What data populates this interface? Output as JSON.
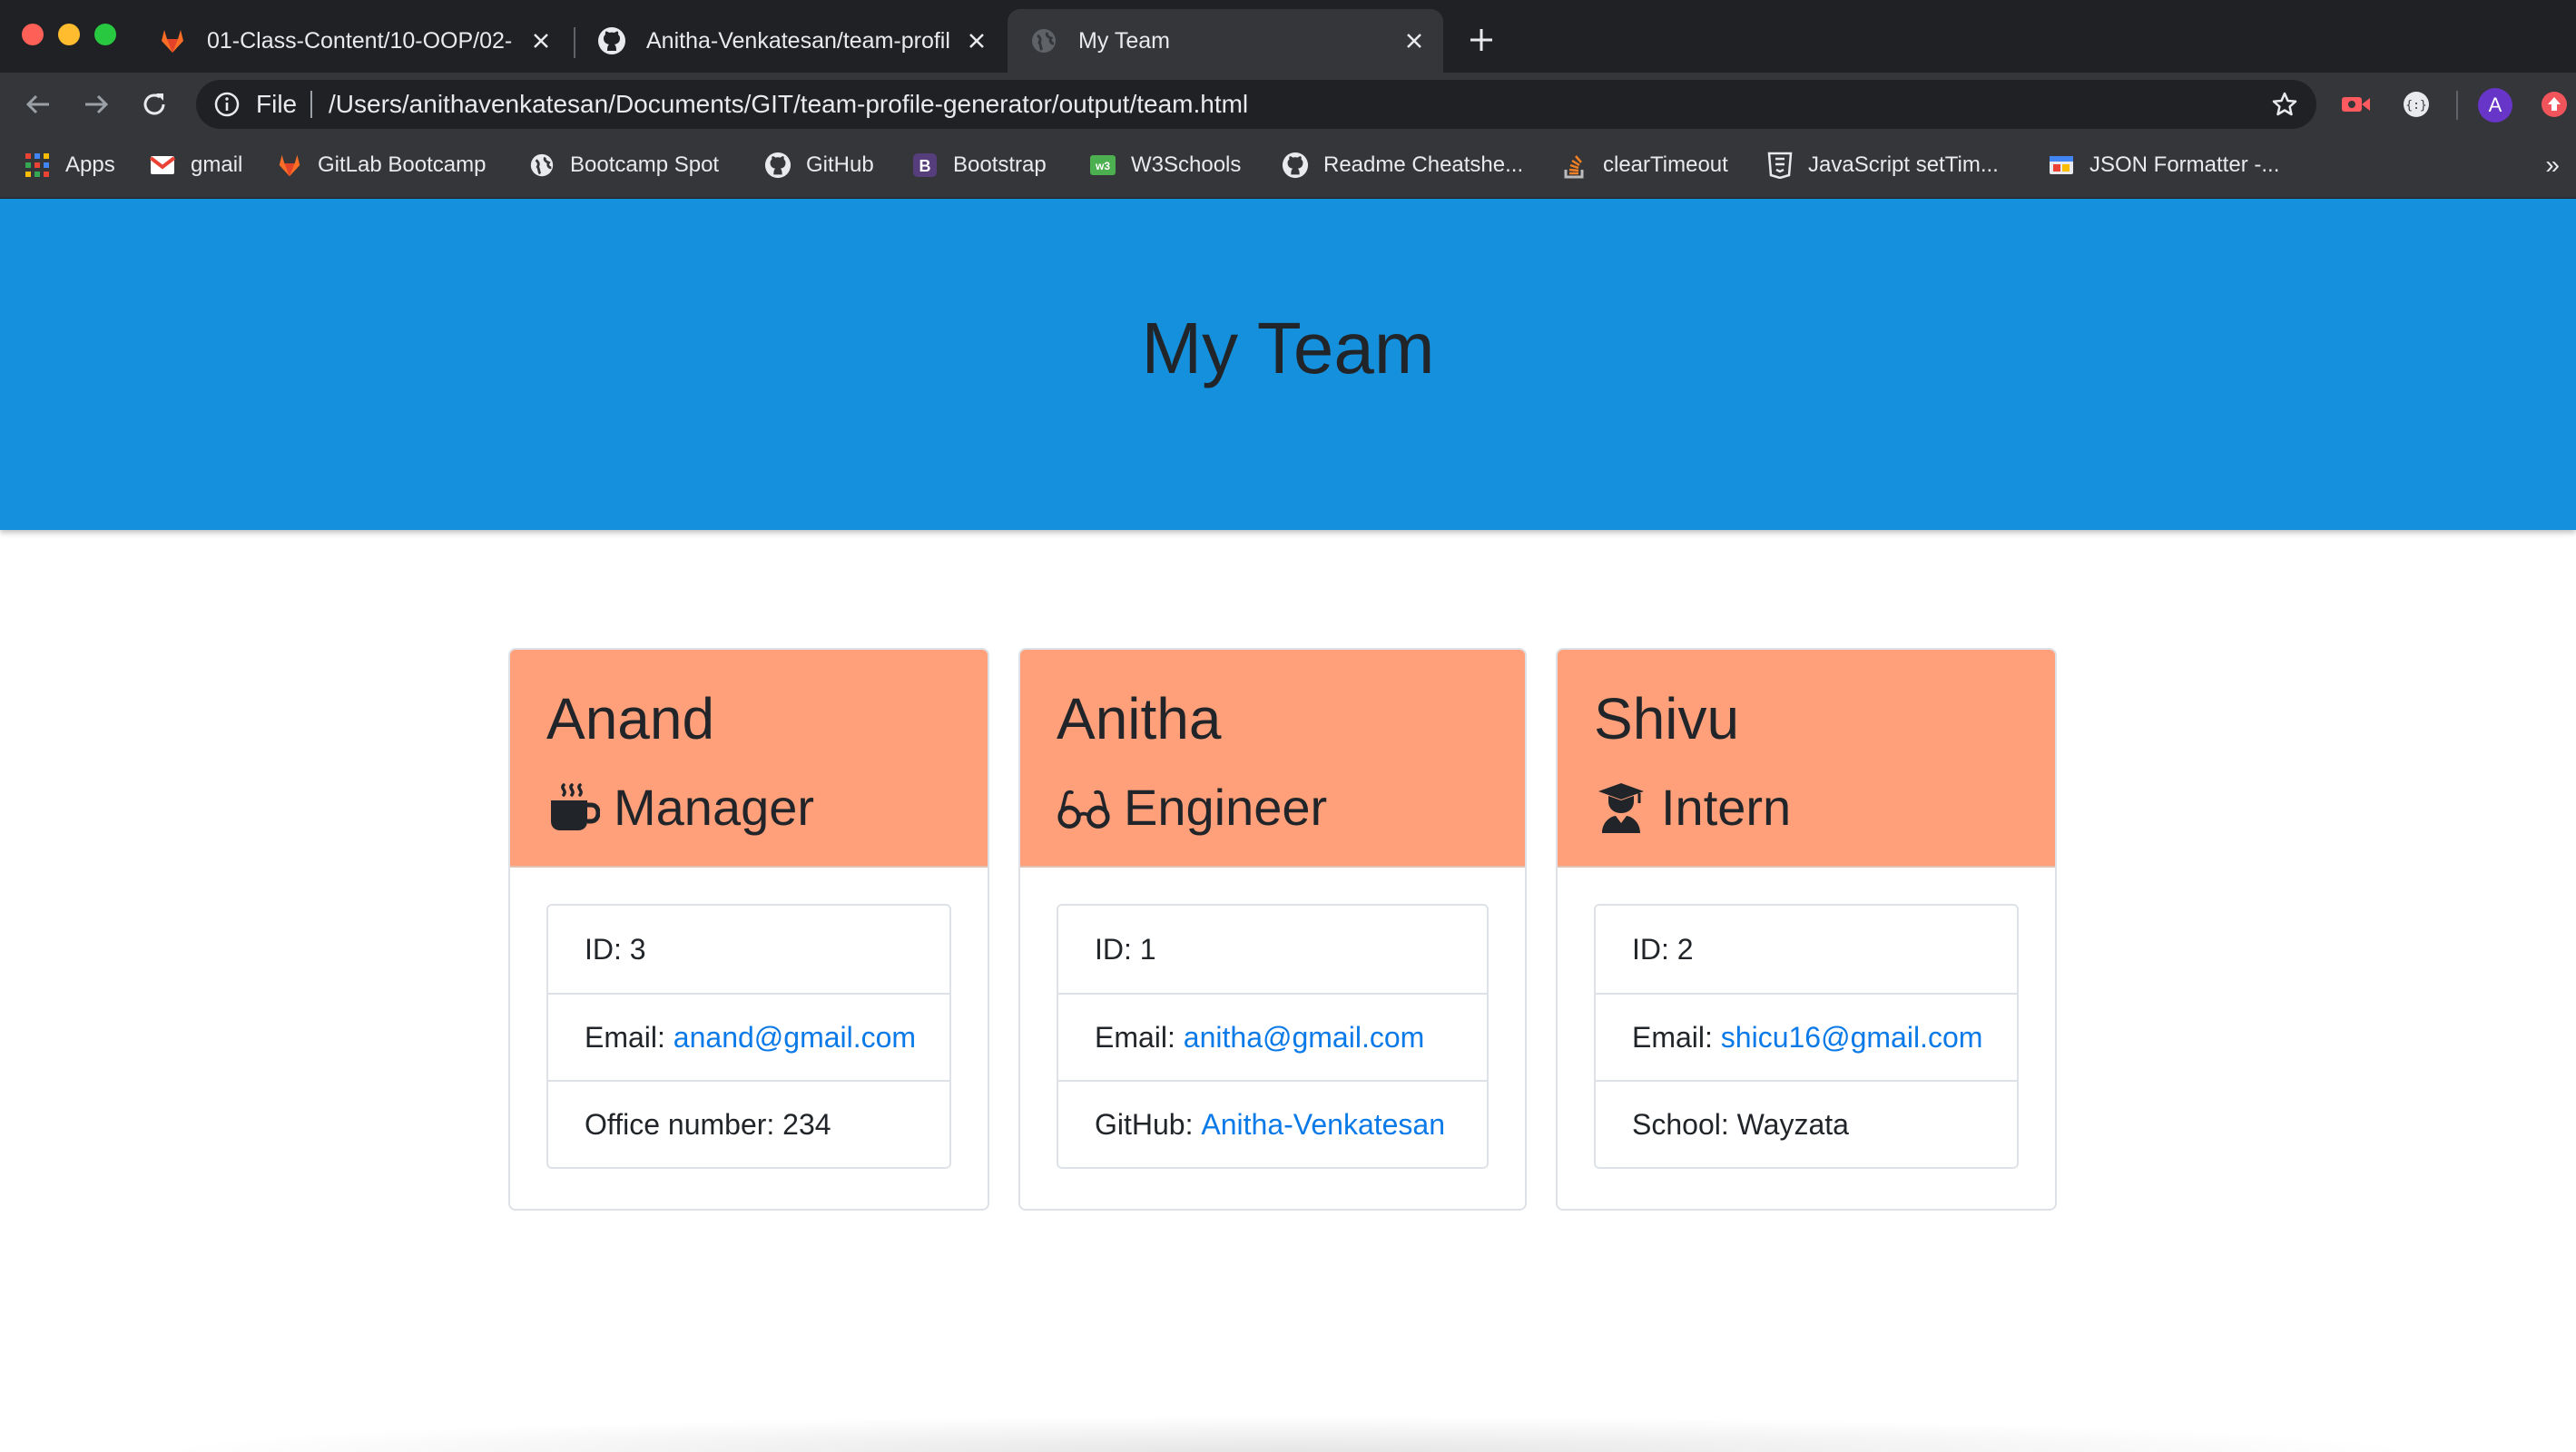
{
  "browser": {
    "tabs": [
      {
        "title": "01-Class-Content/10-OOP/02-",
        "icon": "gitlab-icon"
      },
      {
        "title": "Anitha-Venkatesan/team-profil",
        "icon": "github-icon"
      },
      {
        "title": "My Team",
        "icon": "globe-icon",
        "active": true
      }
    ],
    "address": {
      "scheme_label": "File",
      "url": "/Users/anithavenkatesan/Documents/GIT/team-profile-generator/output/team.html"
    },
    "avatar_letter": "A",
    "bookmarks": [
      {
        "label": "Apps",
        "icon": "apps-grid-icon"
      },
      {
        "label": "gmail",
        "icon": "gmail-icon"
      },
      {
        "label": "GitLab Bootcamp",
        "icon": "gitlab-icon"
      },
      {
        "label": "Bootcamp Spot",
        "icon": "globe-icon"
      },
      {
        "label": "GitHub",
        "icon": "github-icon"
      },
      {
        "label": "Bootstrap",
        "icon": "bootstrap-icon"
      },
      {
        "label": "W3Schools",
        "icon": "w3schools-icon"
      },
      {
        "label": "Readme Cheatshe...",
        "icon": "github-icon"
      },
      {
        "label": "clearTimeout",
        "icon": "stackoverflow-icon"
      },
      {
        "label": "JavaScript setTim...",
        "icon": "html5-icon"
      },
      {
        "label": "JSON Formatter -...",
        "icon": "json-formatter-icon"
      }
    ],
    "more_label": "»"
  },
  "page": {
    "title": "My Team",
    "colors": {
      "header_bg": "#1590dd",
      "card_header_bg": "#ffa07a",
      "link": "#0a7ae8"
    },
    "employees": [
      {
        "name": "Anand",
        "role": "Manager",
        "role_icon": "coffee-mug-icon",
        "id_label": "ID: 3",
        "email_label": "Email: ",
        "email": "anand@gmail.com",
        "extra_label": "Office number: 234",
        "extra_value": ""
      },
      {
        "name": "Anitha",
        "role": "Engineer",
        "role_icon": "glasses-icon",
        "id_label": "ID: 1",
        "email_label": "Email: ",
        "email": "anitha@gmail.com",
        "extra_label": "GitHub: ",
        "extra_value": "Anitha-Venkatesan"
      },
      {
        "name": "Shivu",
        "role": "Intern",
        "role_icon": "graduate-icon",
        "id_label": "ID: 2",
        "email_label": "Email: ",
        "email": "shicu16@gmail.com",
        "extra_label": "School: Wayzata",
        "extra_value": ""
      }
    ]
  }
}
